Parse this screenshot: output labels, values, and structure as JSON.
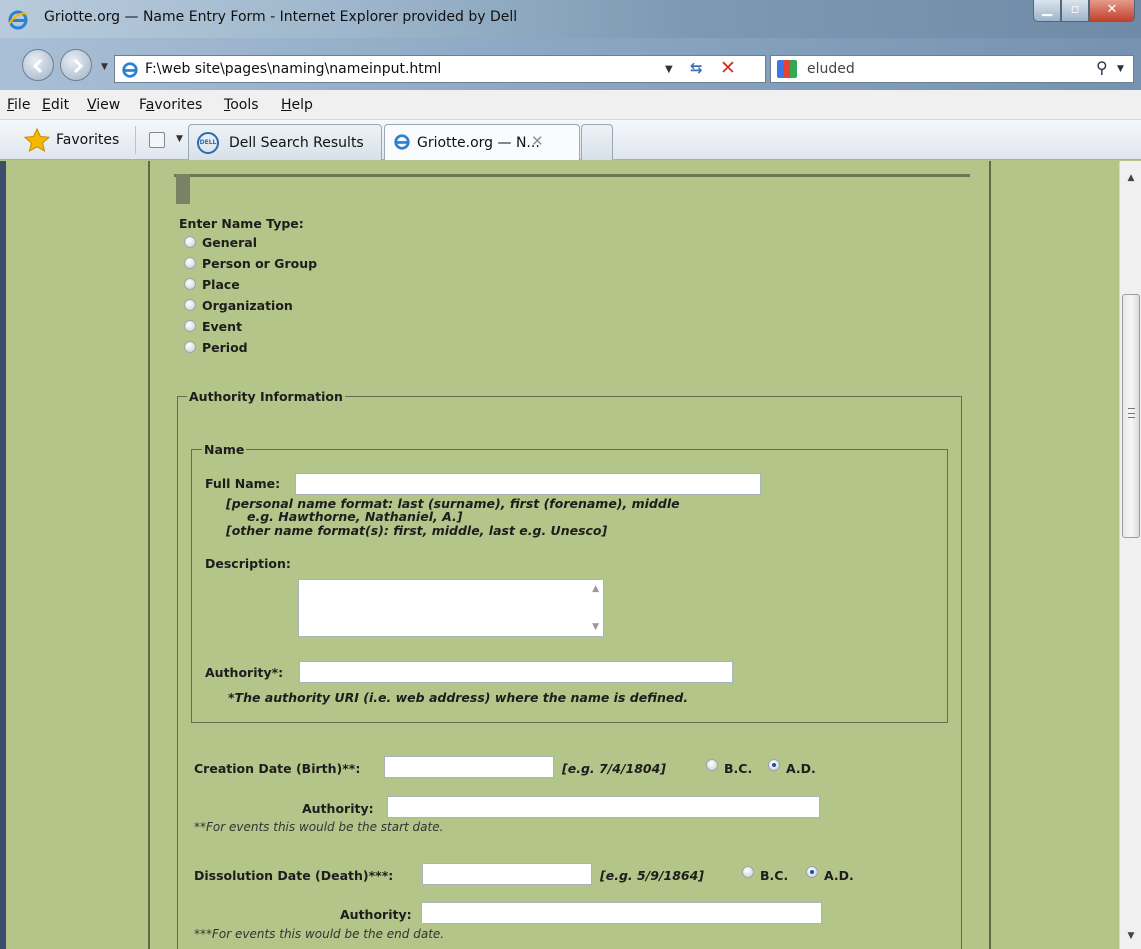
{
  "window": {
    "title": "Griotte.org — Name Entry Form - Internet Explorer provided by Dell",
    "minimize_icon": "minimize-icon",
    "maximize_icon": "maximize-icon",
    "close_icon": "close-icon"
  },
  "address_bar": {
    "url": "F:\\web site\\pages\\naming\\nameinput.html",
    "search_value": "eluded"
  },
  "menu": {
    "items": [
      {
        "label": "File",
        "accel": "F",
        "rest": "ile"
      },
      {
        "label": "Edit",
        "accel": "E",
        "rest": "dit"
      },
      {
        "label": "View",
        "accel": "V",
        "rest": "iew"
      },
      {
        "label": "Favorites",
        "accel": "a",
        "pre": "F",
        "rest": "vorites"
      },
      {
        "label": "Tools",
        "accel": "T",
        "rest": "ools"
      },
      {
        "label": "Help",
        "accel": "H",
        "rest": "elp"
      }
    ]
  },
  "favorites_bar": {
    "favorites_label": "Favorites",
    "tabs": [
      {
        "label": "Dell Search Results"
      },
      {
        "label": "Griotte.org — N..."
      }
    ]
  },
  "form": {
    "name_type": {
      "heading": "Enter Name Type:",
      "options": [
        "General",
        "Person or Group",
        "Place",
        "Organization",
        "Event",
        "Period"
      ]
    },
    "authority_info": {
      "legend": "Authority Information",
      "name_legend": "Name",
      "full_name_label": "Full Name:",
      "format_line1": "[personal name format: last (surname), first (forename), middle",
      "format_line2": "e.g. Hawthorne, Nathaniel, A.]",
      "format_line3": "[other name format(s): first, middle, last e.g. Unesco]",
      "description_label": "Description:",
      "authority_label": "Authority*:",
      "authority_note": "*The authority URI (i.e. web address) where the name is defined."
    },
    "creation": {
      "label": "Creation Date (Birth)**:",
      "example": "[e.g. 7/4/1804]",
      "bc": "B.C.",
      "ad": "A.D.",
      "selected": "A.D.",
      "authority_label": "Authority:",
      "note": "**For events this would be the start date."
    },
    "dissolution": {
      "label": "Dissolution Date (Death)***:",
      "example": "[e.g. 5/9/1864]",
      "bc": "B.C.",
      "ad": "A.D.",
      "selected": "A.D.",
      "authority_label": "Authority:",
      "note": "***For events this would be the end date."
    }
  }
}
